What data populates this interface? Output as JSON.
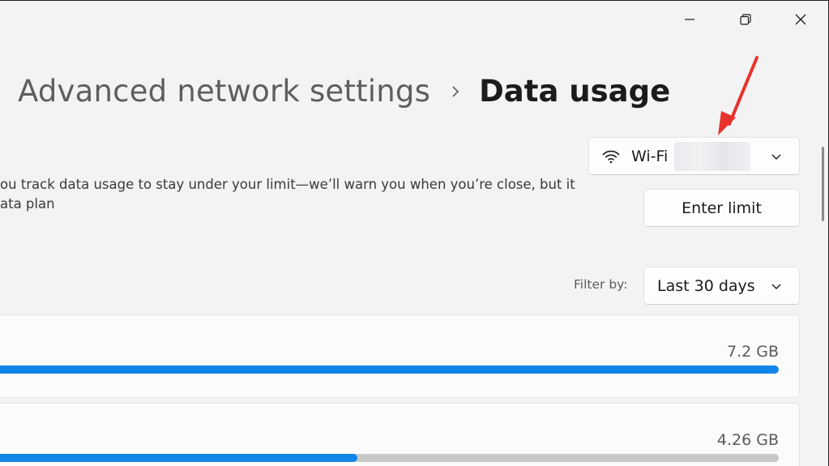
{
  "breadcrumb": {
    "parent": "Advanced network settings",
    "current": "Data usage"
  },
  "network_select": {
    "label": "Wi-Fi"
  },
  "limit": {
    "button_label": "Enter limit"
  },
  "description": {
    "line1": "ou track data usage to stay under your limit—we’ll warn you when you’re close, but it",
    "line2": "ata plan"
  },
  "filter": {
    "label": "Filter by:",
    "selected": "Last 30 days"
  },
  "usage": [
    {
      "amount": "7.2 GB",
      "fraction": 1.0
    },
    {
      "amount": "4.26 GB",
      "fraction": 0.459
    }
  ],
  "colors": {
    "accent": "#0f85e8",
    "annotation_arrow": "#e8322c"
  },
  "icons": {
    "minimize": "minimize-icon",
    "restore": "restore-icon",
    "close": "close-icon",
    "wifi": "wifi-icon",
    "chevron": "chevron-down-icon",
    "breadcrumb_separator": "chevron-right-icon"
  }
}
